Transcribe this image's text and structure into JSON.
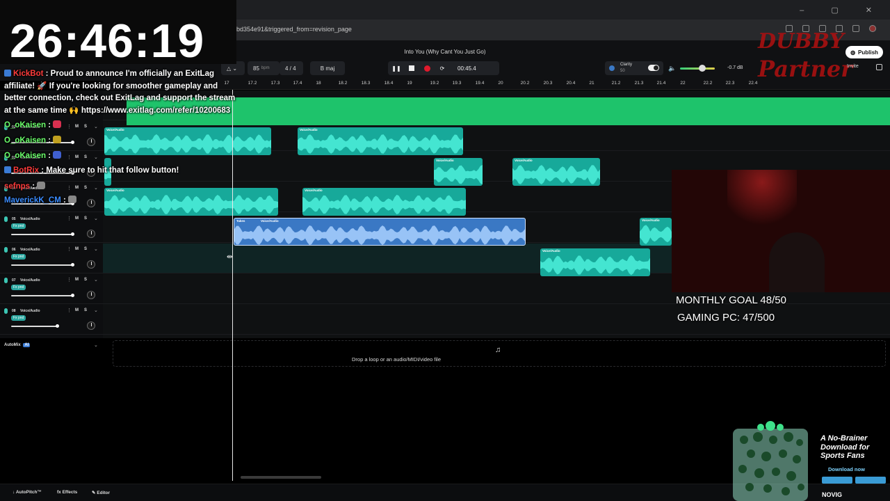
{
  "browser": {
    "url": "bd354e91&triggered_from=revision_page"
  },
  "app": {
    "song_title": "Into You (Why Cant You Just Go)",
    "bpm": "85",
    "bpm_unit": "bpm",
    "time_signature": "4 / 4",
    "key": "B maj",
    "time_display": "00:45.4",
    "clarity_label": "Clarity",
    "clarity_value": "50",
    "master_db": "-0.7 dB",
    "publish_label": "Publish",
    "invite_label": "Invite",
    "colors": {
      "accent": "#17a99a",
      "master": "#1ec36b",
      "selected": "#3a78c4",
      "record": "#e01a2c"
    }
  },
  "ruler": {
    "ticks": [
      "17",
      "17.2",
      "17.3",
      "17.4",
      "18",
      "18.2",
      "18.3",
      "18.4",
      "19",
      "19.2",
      "19.3",
      "19.4",
      "20",
      "20.2",
      "20.3",
      "20.4",
      "21",
      "21.2",
      "21.3",
      "21.4",
      "22",
      "22.2",
      "22.3",
      "22.4"
    ]
  },
  "tracks": [
    {
      "num": "02",
      "name": "Voice/Audio",
      "fx": ""
    },
    {
      "num": "03",
      "name": "Voice/Audio",
      "fx": ""
    },
    {
      "num": "04",
      "name": "Voice/Audio",
      "fx": ""
    },
    {
      "num": "05",
      "name": "Voice/Audio",
      "fx": "Fx pnd"
    },
    {
      "num": "06",
      "name": "Voice/Audio",
      "fx": "Fx pnd"
    },
    {
      "num": "07",
      "name": "Voice/Audio",
      "fx": "Fx pnd"
    },
    {
      "num": "08",
      "name": "Voice/Audio",
      "fx": "Fx pnd"
    }
  ],
  "track_controls": {
    "mute": "M",
    "solo": "S"
  },
  "clips": {
    "voice_label": "Voice/Audio",
    "takes_label": "Takes"
  },
  "automix": {
    "label": "AutoMix",
    "badge": "AI"
  },
  "drop_zone": "Drop a loop or an audio/MIDI/video file",
  "bottom_bar": {
    "autopitch": "AutoPitch™",
    "effects": "Effects",
    "editor": "Editor"
  },
  "overlay": {
    "clock": "26:46:19",
    "chat": [
      {
        "user": "KickBot",
        "text": ": Proud to announce I'm officially an ExitLag"
      },
      {
        "user": "",
        "text": "affiliate! 🚀 If you're looking for smoother gameplay and"
      },
      {
        "user": "",
        "text": "better connection, check out ExitLag and support the stream"
      },
      {
        "user": "",
        "text": "at the same time 🙌 https://www.exitlag.com/refer/10200683"
      },
      {
        "user": "O_oKaisen",
        "text": ":"
      },
      {
        "user": "O_oKaisen",
        "text": ":"
      },
      {
        "user": "O_oKaisen",
        "text": ":"
      },
      {
        "user": "BotRix",
        "text": ": Make sure to hit that follow button!"
      },
      {
        "user": "sefnps",
        "text": ":"
      },
      {
        "user": "MaverickK_CM",
        "text": ":"
      }
    ],
    "goal_line1": "MONTHLY GOAL 48/50",
    "goal_line2": "GAMING PC: 47/500",
    "watermark_top": "DUBBY",
    "watermark_bottom": "Partner"
  },
  "ad": {
    "headline": "A No-Brainer Download for Sports Fans",
    "cta": "Download now",
    "brand": "NOVIG"
  }
}
